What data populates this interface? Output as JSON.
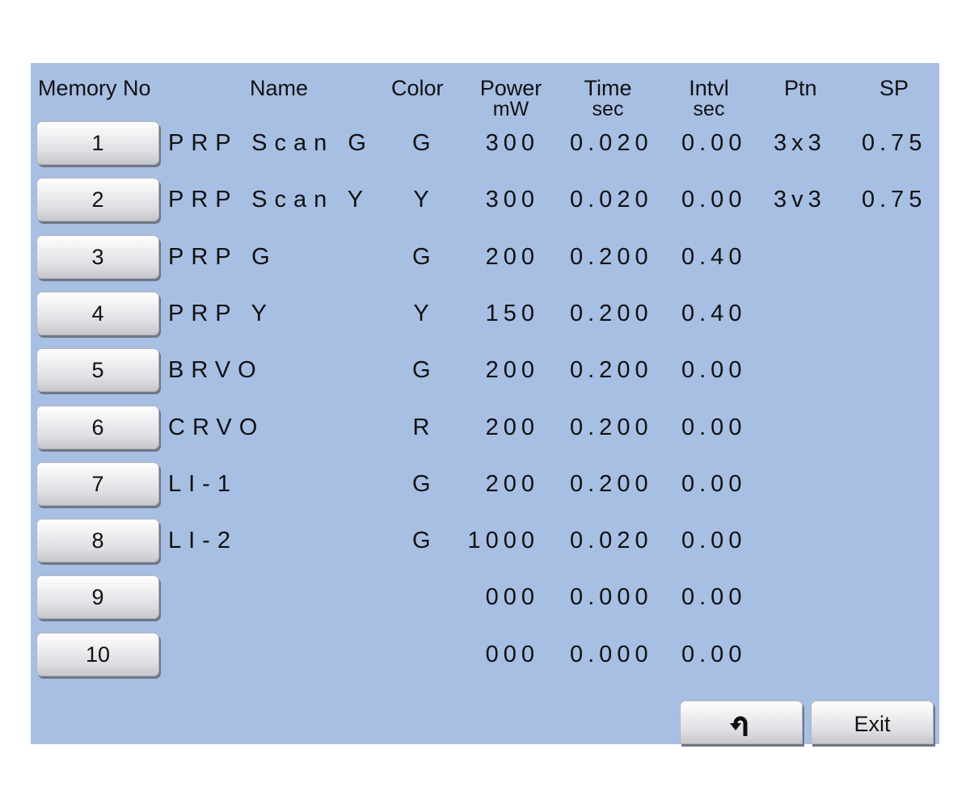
{
  "headers": {
    "memory_no": "Memory No",
    "name": "Name",
    "color": "Color",
    "power": "Power",
    "power_unit": "mW",
    "time": "Time",
    "time_unit": "sec",
    "intvl": "Intvl",
    "intvl_unit": "sec",
    "ptn": "Ptn",
    "sp": "SP"
  },
  "rows": [
    {
      "no": "1",
      "name": "PRP Scan G",
      "color": "G",
      "power": "300",
      "time": "0.020",
      "intvl": "0.00",
      "ptn": "3x3",
      "sp": "0.75"
    },
    {
      "no": "2",
      "name": "PRP Scan Y",
      "color": "Y",
      "power": "300",
      "time": "0.020",
      "intvl": "0.00",
      "ptn": "3v3",
      "sp": "0.75"
    },
    {
      "no": "3",
      "name": "PRP G",
      "color": "G",
      "power": "200",
      "time": "0.200",
      "intvl": "0.40",
      "ptn": "",
      "sp": ""
    },
    {
      "no": "4",
      "name": "PRP Y",
      "color": "Y",
      "power": "150",
      "time": "0.200",
      "intvl": "0.40",
      "ptn": "",
      "sp": ""
    },
    {
      "no": "5",
      "name": "BRVO",
      "color": "G",
      "power": "200",
      "time": "0.200",
      "intvl": "0.00",
      "ptn": "",
      "sp": ""
    },
    {
      "no": "6",
      "name": "CRVO",
      "color": "R",
      "power": "200",
      "time": "0.200",
      "intvl": "0.00",
      "ptn": "",
      "sp": ""
    },
    {
      "no": "7",
      "name": "LI-1",
      "color": "G",
      "power": "200",
      "time": "0.200",
      "intvl": "0.00",
      "ptn": "",
      "sp": ""
    },
    {
      "no": "8",
      "name": "LI-2",
      "color": "G",
      "power": "1000",
      "time": "0.020",
      "intvl": "0.00",
      "ptn": "",
      "sp": ""
    },
    {
      "no": "9",
      "name": "",
      "color": "",
      "power": "000",
      "time": "0.000",
      "intvl": "0.00",
      "ptn": "",
      "sp": ""
    },
    {
      "no": "10",
      "name": "",
      "color": "",
      "power": "000",
      "time": "0.000",
      "intvl": "0.00",
      "ptn": "",
      "sp": ""
    }
  ],
  "buttons": {
    "back_icon": "return-arrow-icon",
    "exit_label": "Exit"
  },
  "colors": {
    "background": "#a7bfe3",
    "button_face": "#e4e4e8",
    "text": "#111111"
  }
}
